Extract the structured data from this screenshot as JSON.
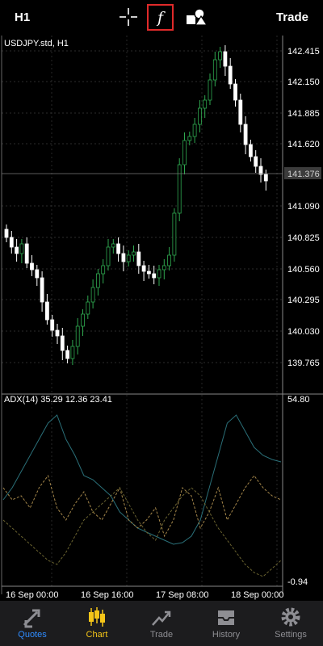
{
  "header": {
    "timeframe": "H1",
    "trade_label": "Trade",
    "icons": [
      "crosshair-icon",
      "indicator-function-icon",
      "objects-shapes-icon"
    ]
  },
  "main_chart": {
    "symbol_label": "USDJPY.std, H1",
    "price_ticks": [
      "142.415",
      "142.150",
      "141.885",
      "141.620",
      "141.090",
      "140.825",
      "140.560",
      "140.295",
      "140.030",
      "139.765"
    ],
    "current_price": "141.376",
    "time_ticks": [
      "16 Sep 00:00",
      "16 Sep 16:00",
      "17 Sep 08:00",
      "18 Sep 00:00"
    ]
  },
  "indicator": {
    "label": "ADX(14) 35.29 12.36 23.41",
    "scale_max": "54.80",
    "scale_min": "-0.94"
  },
  "bottom_nav": {
    "items": [
      {
        "label": "Quotes",
        "icon": "quotes-arrows-icon",
        "color": "#2f8cff"
      },
      {
        "label": "Chart",
        "icon": "candlestick-chart-icon",
        "color": "#f5c518"
      },
      {
        "label": "Trade",
        "icon": "trade-trend-icon",
        "color": "#8e8e93"
      },
      {
        "label": "History",
        "icon": "history-inbox-icon",
        "color": "#8e8e93"
      },
      {
        "label": "Settings",
        "icon": "settings-gear-icon",
        "color": "#8e8e93"
      }
    ]
  },
  "colors": {
    "background": "#000000",
    "bull_candle": "#2fa84f",
    "bear_candle": "#ffffff",
    "adx_line": "#2a6f78",
    "plus_di": "#a5874a",
    "minus_di": "#6b6430",
    "active_tab": "#f5c518",
    "fx_highlight": "#e02a2a"
  }
}
